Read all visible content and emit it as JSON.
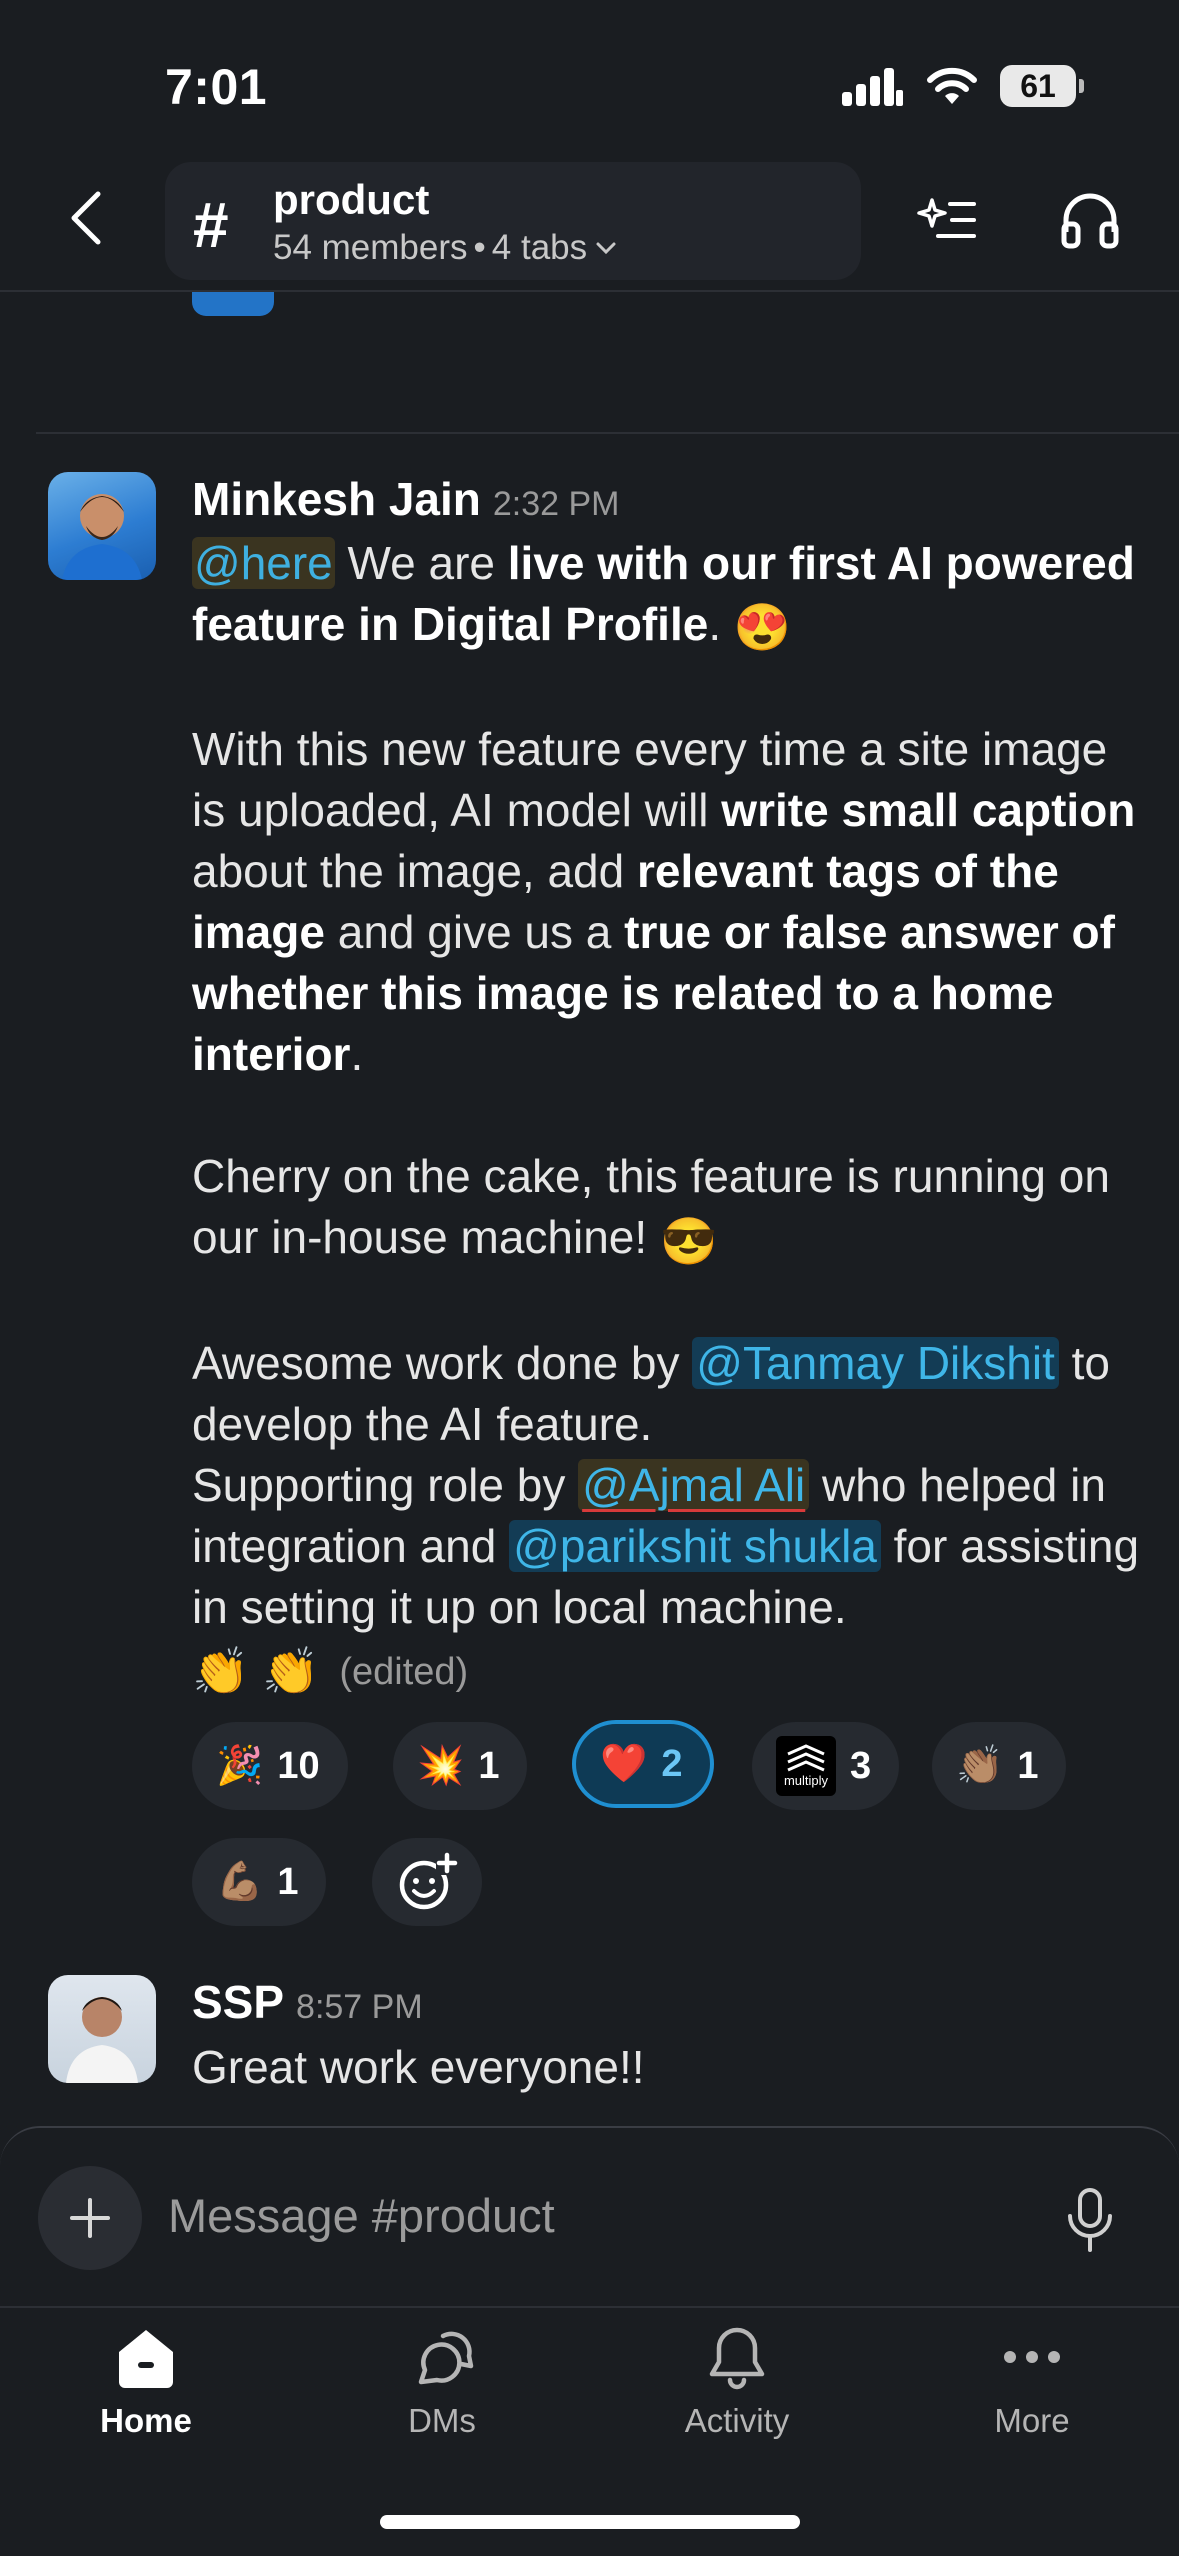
{
  "status_bar": {
    "time": "7:01",
    "battery": "61"
  },
  "header": {
    "channel_prefix": "#",
    "channel_name": "product",
    "members": "54 members",
    "separator": "•",
    "tabs": "4 tabs"
  },
  "message1": {
    "author": "Minkesh Jain",
    "time": "2:32 PM",
    "here_mention": "@here",
    "p1_a": " We are ",
    "p1_b": "live with our first AI powered feature in Digital Profile",
    "p1_c": ". ",
    "p1_emoji": "😍",
    "p2_a": "With this new feature every time a site image is uploaded, AI model will ",
    "p2_b": "write small caption",
    "p2_c": " about the image, add ",
    "p2_d": "relevant tags of the image",
    "p2_e": " and give us a ",
    "p2_f": "true or false answer of whether this image is related to a home interior",
    "p2_g": ".",
    "p3_a": "Cherry on the cake, this feature is running on our in-house machine! ",
    "p3_emoji": "😎",
    "p4_a": "Awesome work done by ",
    "p4_mention1": "@Tanmay Dikshit",
    "p4_b": " to develop the AI feature.",
    "p5_a": "Supporting role by ",
    "p5_mention2": "@Ajmal Ali",
    "p5_b": " who helped in integration and ",
    "p5_mention3": "@parikshit shukla",
    "p5_c": " for assisting in setting it up on local machine.",
    "p6_emoji": "👏 👏",
    "edited": "(edited)"
  },
  "reactions": [
    {
      "emoji": "🎉",
      "count": "10",
      "active": false
    },
    {
      "emoji": "💥",
      "count": "1",
      "active": false
    },
    {
      "emoji": "❤️",
      "count": "2",
      "active": true
    },
    {
      "emoji": "multiply",
      "count": "3",
      "active": false
    },
    {
      "emoji": "👏🏽",
      "count": "1",
      "active": false
    },
    {
      "emoji": "💪🏽",
      "count": "1",
      "active": false
    }
  ],
  "message2": {
    "author": "SSP",
    "time": "8:57 PM",
    "text": "Great work everyone!!"
  },
  "composer": {
    "placeholder": "Message #product"
  },
  "tabbar": {
    "home": "Home",
    "dms": "DMs",
    "activity": "Activity",
    "more": "More"
  },
  "colors": {
    "background": "#1a1d21",
    "mention": "#3fb6e8",
    "active_reaction_border": "#1f8fd1"
  }
}
